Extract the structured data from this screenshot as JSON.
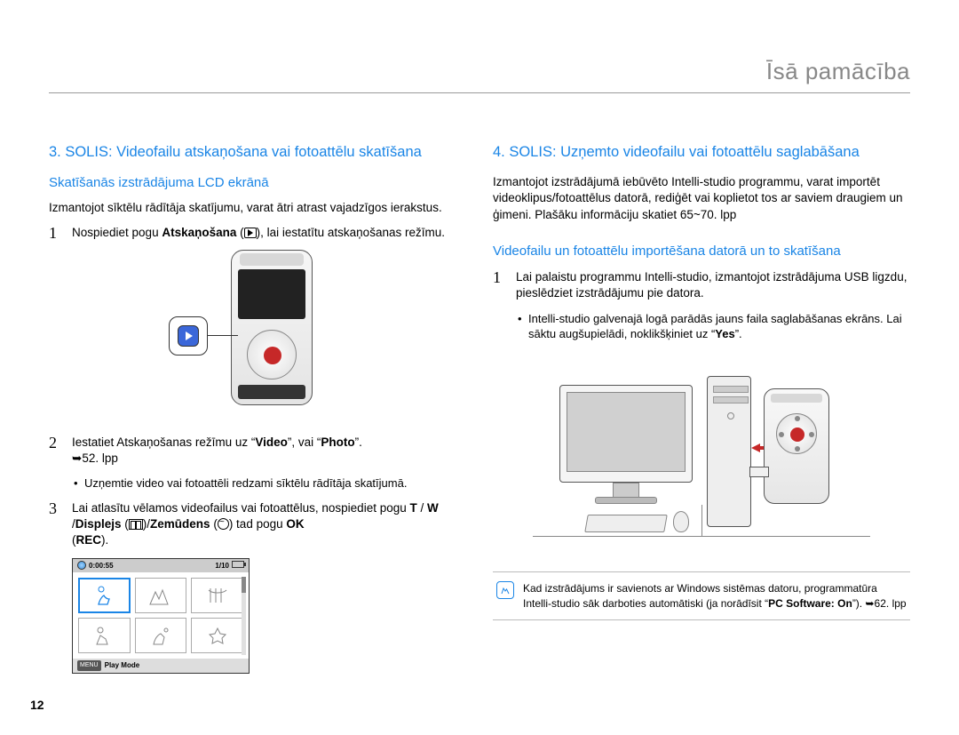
{
  "header": {
    "title": "Īsā pamācība"
  },
  "page_number": "12",
  "left": {
    "step_title": "3. SOLIS: Videofailu atskaņošana vai fotoattēlu skatīšana",
    "subhead": "Skatīšanās izstrādājuma LCD ekrānā",
    "intro": "Izmantojot sīktēlu rādītāja skatījumu, varat ātri atrast vajadzīgos ierakstus.",
    "item1_pre": "Nospiediet pogu ",
    "item1_bold": "Atskaņošana",
    "item1_post": ", lai iestatītu atskaņošanas režīmu.",
    "item2_pre": "Iestatiet Atskaņošanas režīmu uz “",
    "item2_b1": "Video",
    "item2_mid": "”, vai “",
    "item2_b2": "Photo",
    "item2_post": "”. ",
    "item2_ref": "52. lpp",
    "item2_bullet": "Uzņemtie video vai fotoattēli redzami sīktēlu rādītāja skatījumā.",
    "item3_line1": "Lai atlasītu vēlamos videofailus vai fotoattēlus, nospiediet pogu ",
    "item3_b1": "T",
    "item3_s1": " / ",
    "item3_b2": "W",
    "item3_s2": " /",
    "item3_b3": "Displejs",
    "item3_s3": " (",
    "item3_s4": ")/",
    "item3_b4": "Zemūdens",
    "item3_s5": " (",
    "item3_s6": ") tad pogu ",
    "item3_b5": "OK",
    "item3_s7": " (",
    "item3_b6": "REC",
    "item3_s8": ").",
    "thumb": {
      "time": "0:00:55",
      "count": "1/10",
      "menu_label": "Play Mode",
      "menu_chip": "MENU"
    }
  },
  "right": {
    "step_title": "4. SOLIS: Uzņemto videofailu vai fotoattēlu saglabāšana",
    "intro": "Izmantojot izstrādājumā iebūvēto Intelli-studio programmu, varat importēt videoklipus/fotoattēlus datorā, rediģēt vai koplietot tos ar saviem draugiem un ģimeni. Plašāku informāciju skatiet 65~70. lpp",
    "subhead": "Videofailu un fotoattēlu importēšana datorā un to skatīšana",
    "item1": "Lai palaistu programmu Intelli-studio, izmantojot izstrādājuma USB ligzdu, pieslēdziet izstrādājumu pie datora.",
    "item1_bullet_pre": "Intelli-studio galvenajā logā parādās jauns faila saglabāšanas ekrāns. Lai sāktu augšupielādi, noklikšķiniet uz “",
    "item1_bullet_b": "Yes",
    "item1_bullet_post": "”.",
    "note_pre": "Kad izstrādājums ir savienots ar Windows sistēmas datoru, programmatūra Intelli-studio sāk darboties automātiski (ja norādīsit “",
    "note_b": "PC Software: On",
    "note_mid": "”). ",
    "note_ref": "62. lpp"
  }
}
